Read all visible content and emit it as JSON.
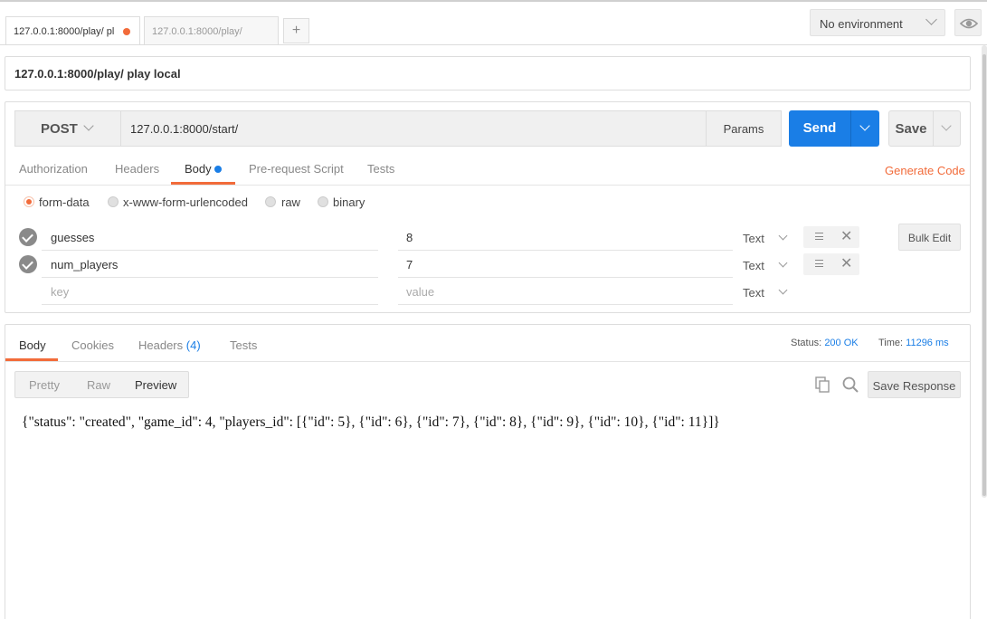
{
  "tabs": [
    {
      "label": "127.0.0.1:8000/play/ pl",
      "active": true,
      "unsaved": true
    },
    {
      "label": "127.0.0.1:8000/play/",
      "active": false,
      "unsaved": false
    }
  ],
  "add_tab_label": "+",
  "environment": {
    "selected": "No environment"
  },
  "request": {
    "name": "127.0.0.1:8000/play/ play local",
    "method": "POST",
    "url": "127.0.0.1:8000/start/",
    "params_label": "Params",
    "send_label": "Send",
    "save_label": "Save"
  },
  "request_tabs": [
    {
      "label": "Authorization"
    },
    {
      "label": "Headers"
    },
    {
      "label": "Body"
    },
    {
      "label": "Pre-request Script"
    },
    {
      "label": "Tests"
    }
  ],
  "generate_code_label": "Generate Code",
  "body_modes": [
    {
      "label": "form-data",
      "selected": true
    },
    {
      "label": "x-www-form-urlencoded",
      "selected": false
    },
    {
      "label": "raw",
      "selected": false
    },
    {
      "label": "binary",
      "selected": false
    }
  ],
  "form_rows": [
    {
      "key": "guesses",
      "value": "8",
      "type": "Text",
      "enabled": true
    },
    {
      "key": "num_players",
      "value": "7",
      "type": "Text",
      "enabled": true
    }
  ],
  "new_row": {
    "key_placeholder": "key",
    "value_placeholder": "value",
    "type": "Text"
  },
  "bulk_edit_label": "Bulk Edit",
  "response_tabs": [
    {
      "label": "Body"
    },
    {
      "label": "Cookies"
    },
    {
      "label": "Headers",
      "count": "(4)"
    },
    {
      "label": "Tests"
    }
  ],
  "response_meta": {
    "status_label": "Status:",
    "status_value": "200 OK",
    "time_label": "Time:",
    "time_value": "11296 ms"
  },
  "view_modes": [
    {
      "label": "Pretty"
    },
    {
      "label": "Raw"
    },
    {
      "label": "Preview",
      "active": true
    }
  ],
  "save_response_label": "Save Response",
  "response_body": "{\"status\": \"created\", \"game_id\": 4, \"players_id\": [{\"id\": 5}, {\"id\": 6}, {\"id\": 7}, {\"id\": 8}, {\"id\": 9}, {\"id\": 10}, {\"id\": 11}]}",
  "colors": {
    "accent": "#f26b3a",
    "primary": "#1a7ee6"
  },
  "icons": {
    "eye": "eye-icon",
    "copy": "copy-icon",
    "search": "search-icon",
    "check": "check-icon",
    "remove": "close-icon",
    "reorder": "menu-icon"
  }
}
